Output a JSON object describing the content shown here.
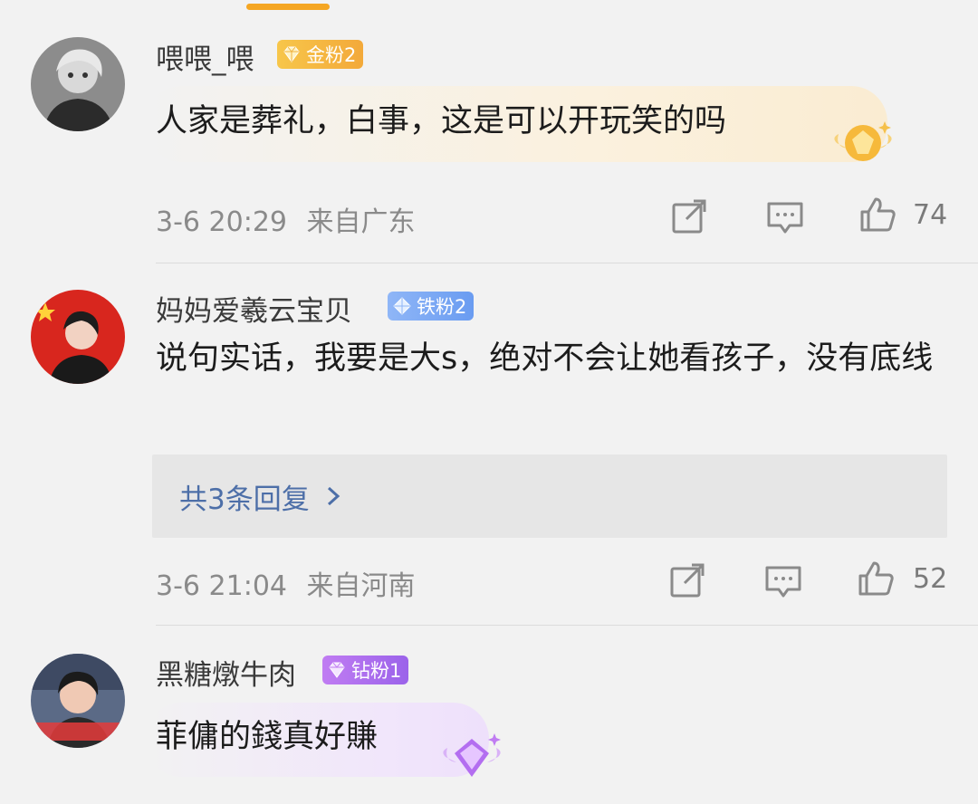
{
  "comments": [
    {
      "username": "喂喂_喂",
      "badge": {
        "label": "金粉2",
        "tier": "gold"
      },
      "text": "人家是葬礼，白事，这是可以开玩笑的吗",
      "time": "3-6 20:29",
      "location": "来自广东",
      "likes": "74",
      "avatar_icon": "avatar-photo-woman-grayscale"
    },
    {
      "username": "妈妈爱羲云宝贝",
      "badge": {
        "label": "铁粉2",
        "tier": "iron"
      },
      "text": "说句实话，我要是大s，绝对不会让她看孩子，没有底线",
      "replies": "共3条回复",
      "time": "3-6 21:04",
      "location": "来自河南",
      "likes": "52",
      "avatar_icon": "avatar-photo-woman-red-flag"
    },
    {
      "username": "黑糖燉牛肉",
      "badge": {
        "label": "钻粉1",
        "tier": "diamond"
      },
      "text": "菲傭的錢真好賺",
      "avatar_icon": "avatar-photo-woman-smiling"
    }
  ],
  "colors": {
    "accent_orange": "#f5a623",
    "reply_link": "#4d6fa8",
    "badge_gold": "#f3a93a",
    "badge_iron": "#6a9cf1",
    "badge_diamond": "#9b63ea"
  }
}
